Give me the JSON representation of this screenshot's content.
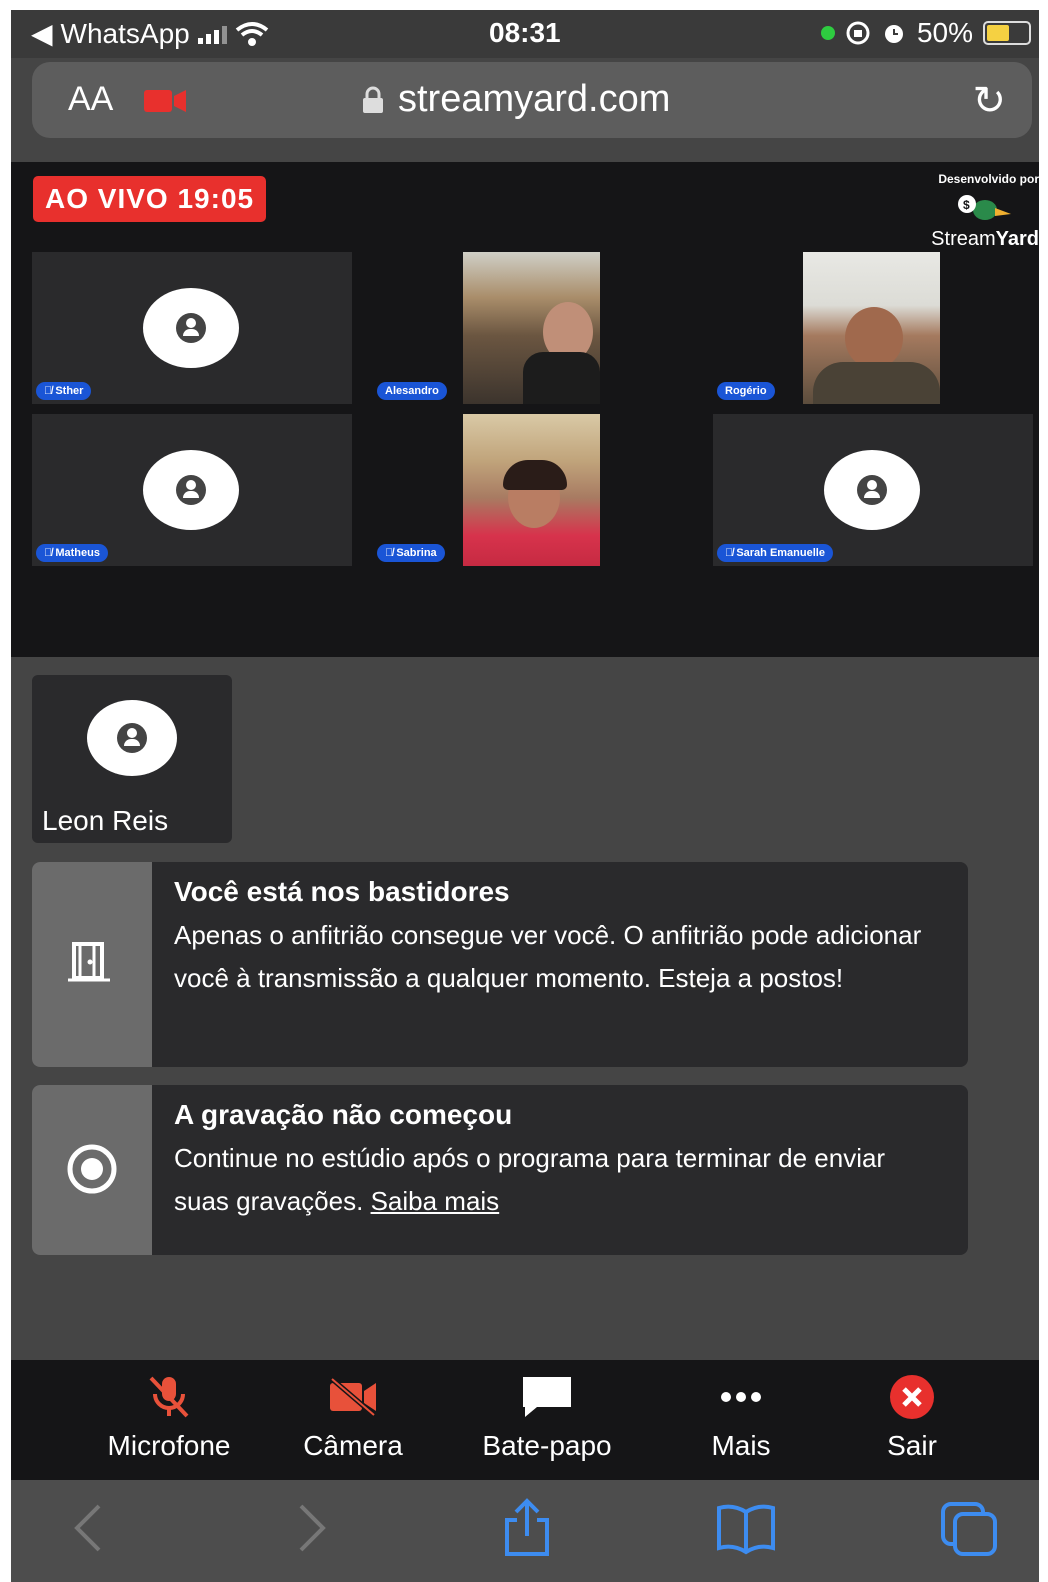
{
  "status_bar": {
    "back_app": "WhatsApp",
    "time": "08:31",
    "battery": "50%",
    "battery_level": 0.5
  },
  "url_bar": {
    "text_size": "AA",
    "host": "streamyard.com"
  },
  "stage": {
    "live_badge": "AO VIVO 19:05",
    "brand_developed_by": "Desenvolvido por",
    "brand_name_a": "Stream",
    "brand_name_b": "Yard",
    "participants": [
      {
        "name": "Sther",
        "muted": true,
        "video": false
      },
      {
        "name": "Alesandro",
        "muted": false,
        "video": true
      },
      {
        "name": "Rogério",
        "muted": false,
        "video": true
      },
      {
        "name": "Matheus",
        "muted": true,
        "video": false
      },
      {
        "name": "Sabrina",
        "muted": true,
        "video": true
      },
      {
        "name": "Sarah Emanuelle",
        "muted": true,
        "video": false
      }
    ]
  },
  "backstage": {
    "self_name": "Leon Reis",
    "notice_backstage": {
      "title": "Você está nos bastidores",
      "text": "Apenas o anfitrião consegue ver você. O anfitrião pode adicionar você à transmissão a qualquer momento. Esteja a postos!"
    },
    "notice_recording": {
      "title": "A gravação não começou",
      "text": "Continue no estúdio após o programa para terminar de enviar suas gravações.",
      "link": "Saiba mais"
    }
  },
  "toolbar": {
    "mic": "Microfone",
    "camera": "Câmera",
    "chat": "Bate-papo",
    "more": "Mais",
    "leave": "Sair"
  },
  "colors": {
    "live_red": "#e8302d",
    "name_tag_blue": "#1a55d6",
    "muted_icon": "#e8513a",
    "safari_blue": "#3d8cf0"
  }
}
